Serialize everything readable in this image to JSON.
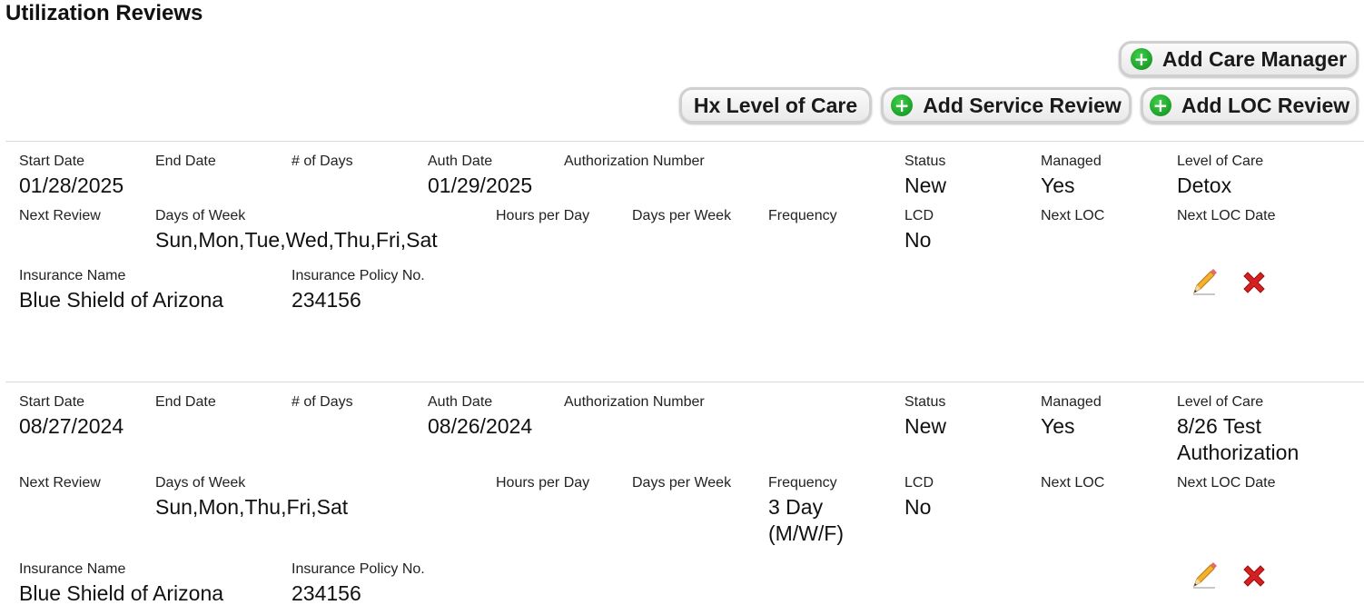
{
  "page": {
    "title": "Utilization Reviews"
  },
  "toolbar": {
    "add_care_manager": "Add Care Manager",
    "hx_level_of_care": "Hx Level of Care",
    "add_service_review": "Add Service Review",
    "add_loc_review": "Add LOC Review"
  },
  "labels": {
    "start_date": "Start Date",
    "end_date": "End Date",
    "num_days": "# of Days",
    "auth_date": "Auth Date",
    "authorization_number": "Authorization Number",
    "status": "Status",
    "managed": "Managed",
    "level_of_care": "Level of Care",
    "next_review": "Next Review",
    "days_of_week": "Days of Week",
    "hours_per_day": "Hours per Day",
    "days_per_week": "Days per Week",
    "frequency": "Frequency",
    "lcd": "LCD",
    "next_loc": "Next LOC",
    "next_loc_date": "Next LOC Date",
    "insurance_name": "Insurance Name",
    "insurance_policy_no": "Insurance Policy No."
  },
  "reviews": [
    {
      "start_date": "01/28/2025",
      "auth_date": "01/29/2025",
      "status": "New",
      "managed": "Yes",
      "level_of_care": "Detox",
      "days_of_week": "Sun,Mon,Tue,Wed,Thu,Fri,Sat",
      "frequency": "",
      "lcd": "No",
      "insurance_name": "Blue Shield of Arizona",
      "insurance_policy_no": "234156"
    },
    {
      "start_date": "08/27/2024",
      "auth_date": "08/26/2024",
      "status": "New",
      "managed": "Yes",
      "level_of_care": "8/26 Test Authorization",
      "days_of_week": "Sun,Mon,Thu,Fri,Sat",
      "frequency": "3 Day (M/W/F)",
      "lcd": "No",
      "insurance_name": "Blue Shield of Arizona",
      "insurance_policy_no": "234156"
    }
  ],
  "icons": {
    "edit": "pencil-icon",
    "delete": "red-x-icon",
    "add": "green-plus-icon"
  },
  "colors": {
    "add_icon": "#1a9a2a",
    "delete_icon": "#d42020",
    "divider": "#d2dde3"
  }
}
